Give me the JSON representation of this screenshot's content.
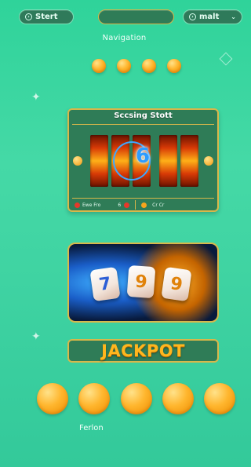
{
  "top_bar": {
    "start_label": "Stert",
    "start_icon": "circle-arrow-icon",
    "center_pill": "",
    "right_label": "malt",
    "right_icon": "circle-arrow-icon",
    "right_chevron": "chevron-down-icon"
  },
  "navigation": {
    "title": "Navigation",
    "dot_count": 4
  },
  "slot_machine": {
    "title": "Sccsing Stott",
    "reel_symbol": "6",
    "footer_left": "Ewe Fro",
    "footer_mid": "6",
    "footer_right": "Cr Cr"
  },
  "dice": {
    "faces": [
      "7",
      "9",
      "9"
    ]
  },
  "jackpot": {
    "label": "JACKPOT"
  },
  "bottom": {
    "coin_count": 5,
    "label": "Ferlon"
  },
  "colors": {
    "background": "#3fd3a2",
    "panel": "#2f7c57",
    "gold_border": "#d8b74a",
    "coin": "#f7a51c",
    "jackpot_text": "#ffb61e"
  }
}
